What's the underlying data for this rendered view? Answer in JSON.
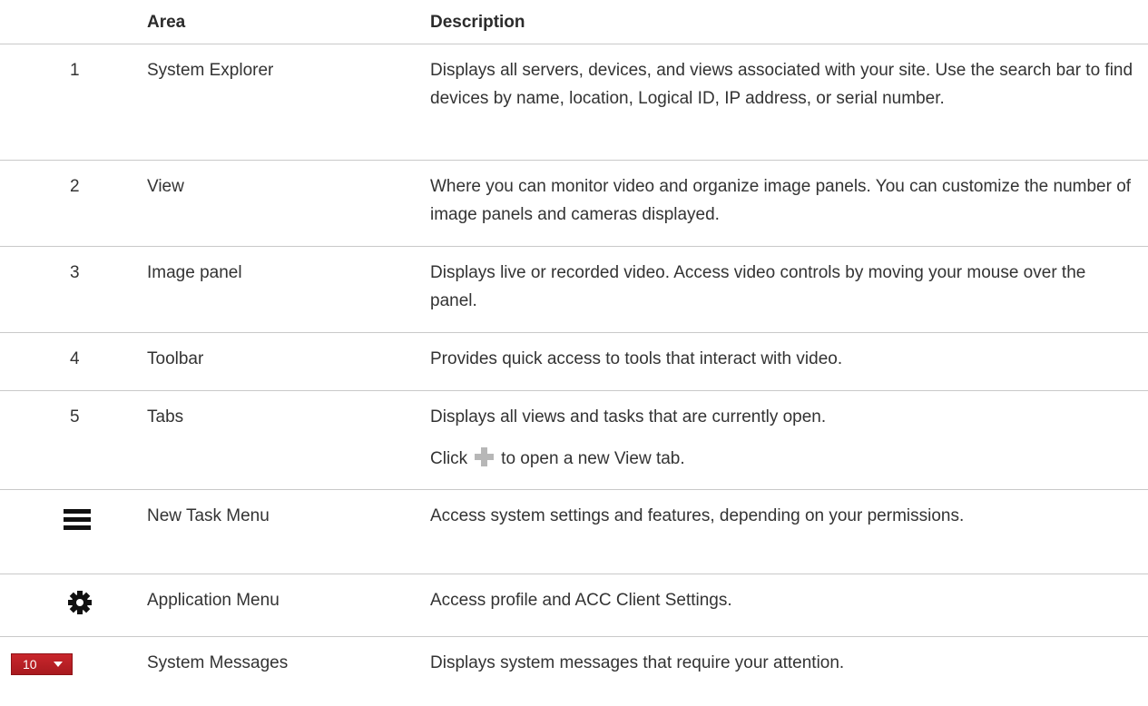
{
  "header": {
    "area": "Area",
    "description": "Description"
  },
  "rows": [
    {
      "num": "1",
      "area": "System Explorer",
      "desc": "Displays all servers, devices, and views associated with your site. Use the search bar to find devices by name, location, Logical ID, IP address, or serial number."
    },
    {
      "num": "2",
      "area": "View",
      "desc": "Where you can monitor video and organize image panels. You can customize the number of image panels and cameras displayed."
    },
    {
      "num": "3",
      "area": "Image panel",
      "desc": "Displays live or recorded video. Access video controls by moving your mouse over the panel."
    },
    {
      "num": "4",
      "area": "Toolbar",
      "desc": "Provides quick access to tools that interact with video."
    },
    {
      "num": "5",
      "area": "Tabs",
      "desc": "Displays all views and tasks that are currently open.",
      "desc2_before": "Click",
      "desc2_after": "to open a new View tab."
    },
    {
      "icon": "hamburger-menu-icon",
      "area": "New Task Menu",
      "desc": "Access system settings and features, depending on your permissions."
    },
    {
      "icon": "gear-icon",
      "area": "Application Menu",
      "desc": "Access profile and ACC Client Settings."
    },
    {
      "icon": "system-messages-widget",
      "icon_count": "10",
      "area": "System Messages",
      "desc": "Displays system messages that require your attention."
    }
  ],
  "colors": {
    "text": "#333333",
    "rule": "#c9c9c9",
    "plus_icon": "#b7b7b7",
    "sysmsg_red": "#c9262c"
  }
}
